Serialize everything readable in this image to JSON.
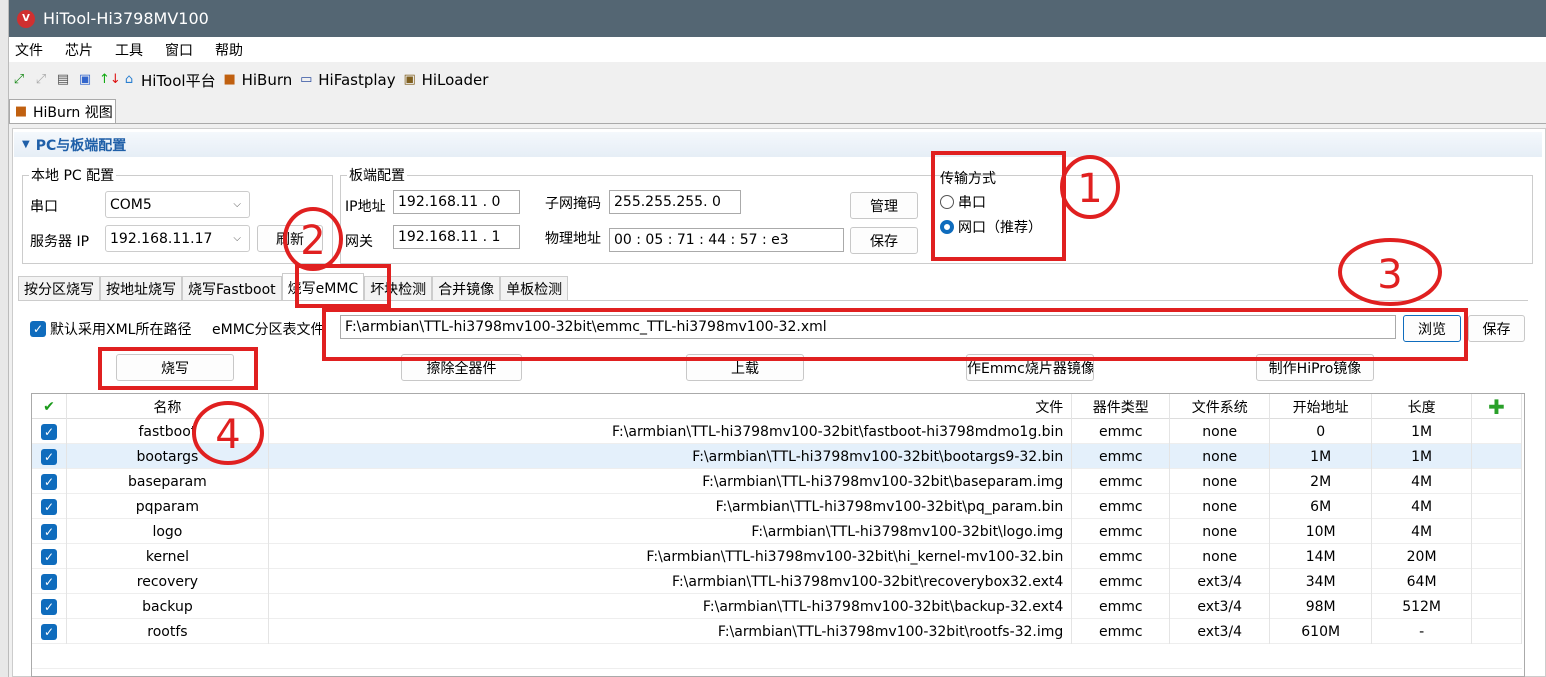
{
  "window": {
    "title": "HiTool-Hi3798MV100",
    "logo": "HiTool"
  },
  "menu": [
    "文件",
    "芯片",
    "工具",
    "窗口",
    "帮助"
  ],
  "toolbar": {
    "items": [
      {
        "label": "HiTool平台",
        "icon": "home-icon"
      },
      {
        "label": "HiBurn",
        "icon": "hiburn-icon"
      },
      {
        "label": "HiFastplay",
        "icon": "hifastplay-icon"
      },
      {
        "label": "HiLoader",
        "icon": "hiloader-icon"
      }
    ]
  },
  "view_tab": "HiBurn 视图",
  "section": {
    "title": "PC与板端配置"
  },
  "pc": {
    "legend": "本地 PC 配置",
    "serial_label": "串口",
    "serial_value": "COM5",
    "server_ip_label": "服务器 IP",
    "server_ip_value": "192.168.11.17",
    "refresh": "刷新"
  },
  "board": {
    "legend": "板端配置",
    "ip_label": "IP地址",
    "ip_value": "192.168.11 . 0",
    "gateway_label": "网关",
    "gateway_value": "192.168.11 . 1",
    "mask_label": "子网掩码",
    "mask_value": "255.255.255. 0",
    "mac_label": "物理地址",
    "mac_value": "00 : 05 : 71 : 44 : 57 : e3",
    "manage": "管理",
    "save": "保存"
  },
  "transfer": {
    "legend": "传输方式",
    "options": [
      "串口",
      "网口（推荐）"
    ],
    "selected": 1
  },
  "tabs": [
    "按分区烧写",
    "按地址烧写",
    "烧写Fastboot",
    "烧写eMMC",
    "坏块检测",
    "合并镜像",
    "单板检测"
  ],
  "active_tab": 3,
  "emmc": {
    "default_xml_label": "默认采用XML所在路径",
    "default_xml_checked": true,
    "table_file_label": "eMMC分区表文件",
    "table_file_value": "F:\\armbian\\TTL-hi3798mv100-32bit\\emmc_TTL-hi3798mv100-32.xml",
    "browse": "浏览",
    "save": "保存",
    "burn": "烧写",
    "erase": "擦除全器件",
    "upload": "上载",
    "make_emmc": "作Emmc烧片器镜像",
    "make_hipro": "制作HiPro镜像"
  },
  "table": {
    "headers": [
      "名称",
      "文件",
      "器件类型",
      "文件系统",
      "开始地址",
      "长度"
    ],
    "selected_row": 1,
    "rows": [
      [
        "fastboot",
        "F:\\armbian\\TTL-hi3798mv100-32bit\\fastboot-hi3798mdmo1g.bin",
        "emmc",
        "none",
        "0",
        "1M"
      ],
      [
        "bootargs",
        "F:\\armbian\\TTL-hi3798mv100-32bit\\bootargs9-32.bin",
        "emmc",
        "none",
        "1M",
        "1M"
      ],
      [
        "baseparam",
        "F:\\armbian\\TTL-hi3798mv100-32bit\\baseparam.img",
        "emmc",
        "none",
        "2M",
        "4M"
      ],
      [
        "pqparam",
        "F:\\armbian\\TTL-hi3798mv100-32bit\\pq_param.bin",
        "emmc",
        "none",
        "6M",
        "4M"
      ],
      [
        "logo",
        "F:\\armbian\\TTL-hi3798mv100-32bit\\logo.img",
        "emmc",
        "none",
        "10M",
        "4M"
      ],
      [
        "kernel",
        "F:\\armbian\\TTL-hi3798mv100-32bit\\hi_kernel-mv100-32.bin",
        "emmc",
        "none",
        "14M",
        "20M"
      ],
      [
        "recovery",
        "F:\\armbian\\TTL-hi3798mv100-32bit\\recoverybox32.ext4",
        "emmc",
        "ext3/4",
        "34M",
        "64M"
      ],
      [
        "backup",
        "F:\\armbian\\TTL-hi3798mv100-32bit\\backup-32.ext4",
        "emmc",
        "ext3/4",
        "98M",
        "512M"
      ],
      [
        "rootfs",
        "F:\\armbian\\TTL-hi3798mv100-32bit\\rootfs-32.img",
        "emmc",
        "ext3/4",
        "610M",
        "-"
      ]
    ]
  },
  "annotations": {
    "color": "#e02020",
    "numbers": [
      "1",
      "2",
      "3",
      "4"
    ]
  },
  "colors": {
    "titlebar": "#546673",
    "accent": "#0f6cbd",
    "section": "#1f5fa8"
  }
}
